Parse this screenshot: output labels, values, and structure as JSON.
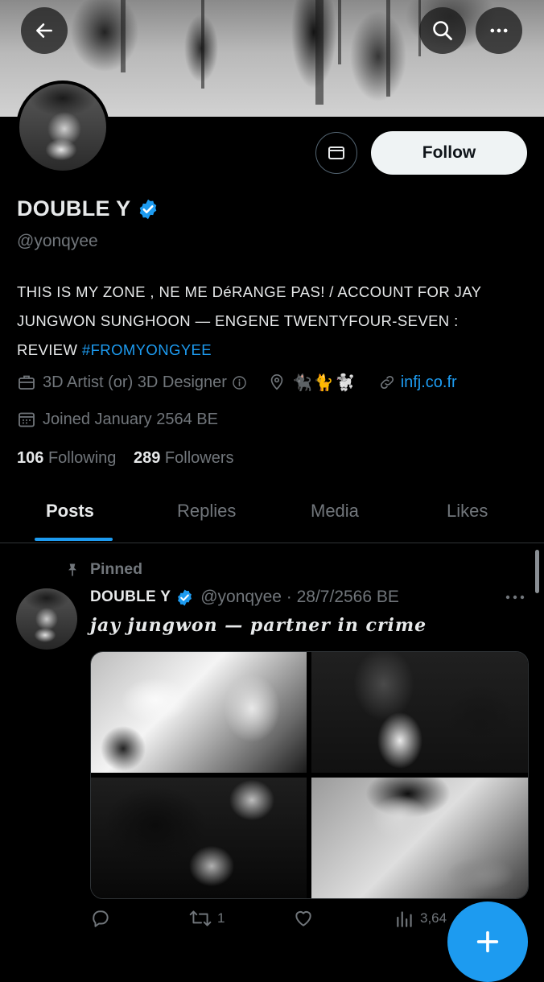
{
  "header": {
    "back_icon": "arrow-left-icon",
    "search_icon": "search-icon",
    "more_icon": "more-horizontal-icon"
  },
  "profile": {
    "display_name": "DOUBLE Y",
    "handle": "@yonqyee",
    "verified_color": "#1d9bf0",
    "message_icon": "mail-icon",
    "follow_label": "Follow",
    "bio": {
      "line1": "THIS IS MY ZONE , NE ME DéRANGE PAS! / ACCOUNT FOR JAY",
      "line2": "JUNGWON SUNGHOON — ENGENE TWENTYFOUR-SEVEN :",
      "line3_prefix": "REVIEW ",
      "line3_hashtag": "#FROMYONGYEE"
    },
    "category": "3D Artist (or) 3D Designer",
    "location": "🐈‍⬛🐈🐩",
    "website": "infj.co.fr",
    "joined": "Joined January 2564 BE",
    "following_count": "106",
    "following_label": "Following",
    "followers_count": "289",
    "followers_label": "Followers"
  },
  "tabs": [
    {
      "label": "Posts",
      "active": true
    },
    {
      "label": "Replies",
      "active": false
    },
    {
      "label": "Media",
      "active": false
    },
    {
      "label": "Likes",
      "active": false
    }
  ],
  "pinned_post": {
    "pinned_label": "Pinned",
    "author": "DOUBLE Y",
    "handle_date": "@yonqyee · 28/7/2566 BE",
    "text": "jay jungwon — partner in crime",
    "actions": {
      "replies": "",
      "reposts": "1",
      "likes": "",
      "views": "3,64"
    }
  },
  "colors": {
    "background": "#000000",
    "accent": "#1d9bf0",
    "muted_text": "#71767b",
    "primary_text": "#e7e9ea"
  }
}
